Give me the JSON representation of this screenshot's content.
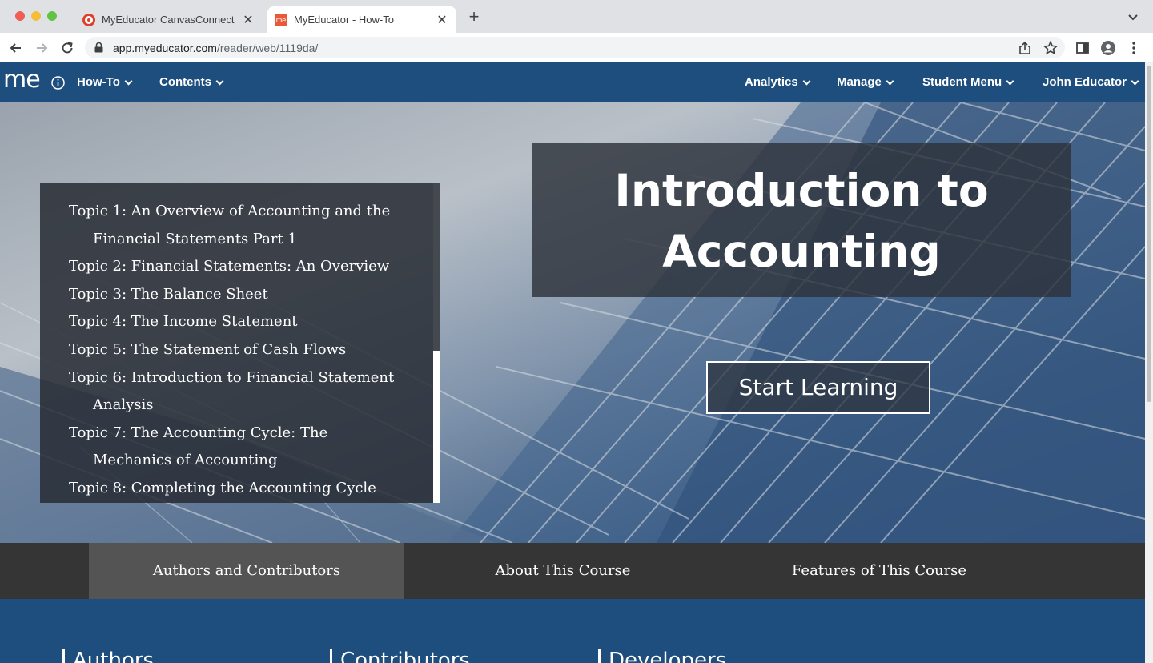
{
  "browser": {
    "tabs": [
      {
        "title": "MyEducator CanvasConnect",
        "favicon": "canvas-logo-icon",
        "active": false
      },
      {
        "title": "MyEducator - How-To",
        "favicon": "myeducator-logo-icon",
        "active": true
      }
    ],
    "url_host": "app.myeducator.com",
    "url_path": "/reader/web/1119da/"
  },
  "appnav": {
    "logo": "me",
    "left_items": [
      "How-To",
      "Contents"
    ],
    "right_items": [
      "Analytics",
      "Manage",
      "Student Menu",
      "John Educator"
    ]
  },
  "toc": {
    "items": [
      "Topic 1: An Overview of Accounting and the Financial Statements Part 1",
      "Topic 2: Financial Statements: An Overview",
      "Topic 3: The Balance Sheet",
      "Topic 4: The Income Statement",
      "Topic 5: The Statement of Cash Flows",
      "Topic 6: Introduction to Financial Statement Analysis",
      "Topic 7: The Accounting Cycle: The Mechanics of Accounting",
      "Topic 8: Completing the Accounting Cycle"
    ]
  },
  "hero": {
    "title": "Introduction to Accounting",
    "start_label": "Start Learning"
  },
  "info_tabs": {
    "items": [
      "Authors and Contributors",
      "About This Course",
      "Features of This Course"
    ],
    "active_index": 0
  },
  "bottom": {
    "headings": [
      "Authors",
      "Contributors",
      "Developers"
    ]
  },
  "colors": {
    "nav_blue": "#1d4e7d",
    "tabbar_gray": "#353535",
    "tab_active_gray": "#545454"
  }
}
